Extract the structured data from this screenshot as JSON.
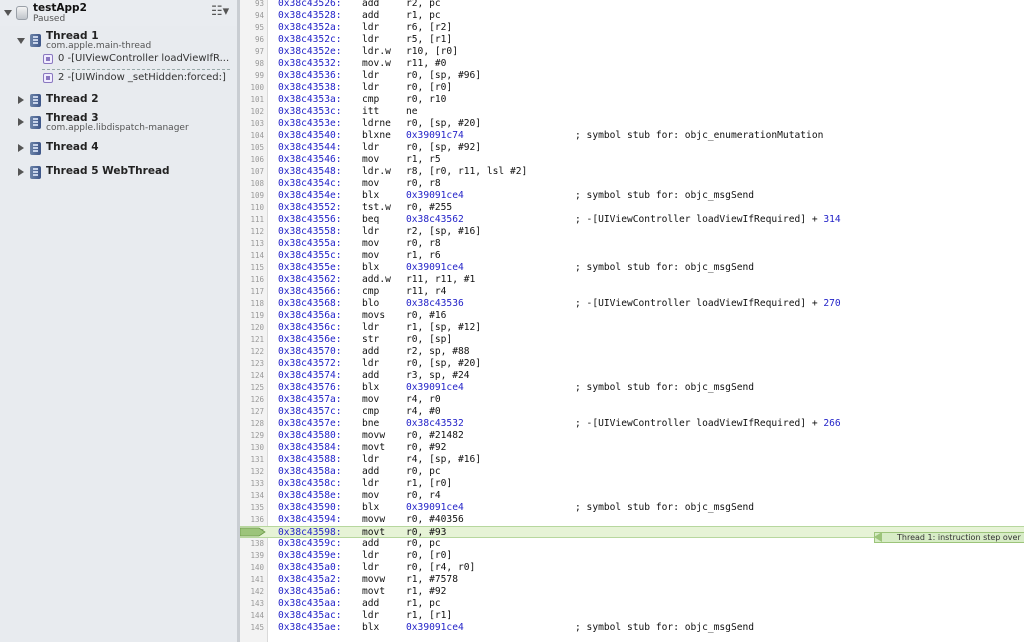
{
  "process": {
    "name": "testApp2",
    "status": "Paused"
  },
  "threads": [
    {
      "label": "Thread 1",
      "subtitle": "com.apple.main-thread",
      "expanded": true
    },
    {
      "label": "Thread 2",
      "subtitle": "",
      "expanded": false
    },
    {
      "label": "Thread 3",
      "subtitle": "com.apple.libdispatch-manager",
      "expanded": false
    },
    {
      "label": "Thread 4",
      "subtitle": "",
      "expanded": false
    },
    {
      "label": "Thread 5 WebThread",
      "subtitle": "",
      "expanded": false
    }
  ],
  "frames": [
    {
      "text": "0 -[UIViewController loadViewIfR..."
    },
    {
      "text": "2 -[UIWindow _setHidden:forced:]"
    }
  ],
  "current_line_annotation": "Thread 1: instruction step over",
  "disassembly": [
    {
      "line": "93",
      "addr": "0x38c43526:",
      "mnemonic": "add",
      "operands": "r2, pc",
      "target": "",
      "comment": "",
      "offset": ""
    },
    {
      "line": "94",
      "addr": "0x38c43528:",
      "mnemonic": "add",
      "operands": "r1, pc",
      "target": "",
      "comment": "",
      "offset": ""
    },
    {
      "line": "95",
      "addr": "0x38c4352a:",
      "mnemonic": "ldr",
      "operands": "r6, [r2]",
      "target": "",
      "comment": "",
      "offset": ""
    },
    {
      "line": "96",
      "addr": "0x38c4352c:",
      "mnemonic": "ldr",
      "operands": "r5, [r1]",
      "target": "",
      "comment": "",
      "offset": ""
    },
    {
      "line": "97",
      "addr": "0x38c4352e:",
      "mnemonic": "ldr.w",
      "operands": "r10, [r0]",
      "target": "",
      "comment": "",
      "offset": ""
    },
    {
      "line": "98",
      "addr": "0x38c43532:",
      "mnemonic": "mov.w",
      "operands": "r11, #0",
      "target": "",
      "comment": "",
      "offset": ""
    },
    {
      "line": "99",
      "addr": "0x38c43536:",
      "mnemonic": "ldr",
      "operands": "r0, [sp, #96]",
      "target": "",
      "comment": "",
      "offset": ""
    },
    {
      "line": "100",
      "addr": "0x38c43538:",
      "mnemonic": "ldr",
      "operands": "r0, [r0]",
      "target": "",
      "comment": "",
      "offset": ""
    },
    {
      "line": "101",
      "addr": "0x38c4353a:",
      "mnemonic": "cmp",
      "operands": "r0, r10",
      "target": "",
      "comment": "",
      "offset": ""
    },
    {
      "line": "102",
      "addr": "0x38c4353c:",
      "mnemonic": "itt",
      "operands": "ne",
      "target": "",
      "comment": "",
      "offset": ""
    },
    {
      "line": "103",
      "addr": "0x38c4353e:",
      "mnemonic": "ldrne",
      "operands": "r0, [sp, #20]",
      "target": "",
      "comment": "",
      "offset": ""
    },
    {
      "line": "104",
      "addr": "0x38c43540:",
      "mnemonic": "blxne",
      "operands": "",
      "target": "0x39091c74",
      "comment": "; symbol stub for: objc_enumerationMutation",
      "offset": ""
    },
    {
      "line": "105",
      "addr": "0x38c43544:",
      "mnemonic": "ldr",
      "operands": "r0, [sp, #92]",
      "target": "",
      "comment": "",
      "offset": ""
    },
    {
      "line": "106",
      "addr": "0x38c43546:",
      "mnemonic": "mov",
      "operands": "r1, r5",
      "target": "",
      "comment": "",
      "offset": ""
    },
    {
      "line": "107",
      "addr": "0x38c43548:",
      "mnemonic": "ldr.w",
      "operands": "r8, [r0, r11, lsl #2]",
      "target": "",
      "comment": "",
      "offset": ""
    },
    {
      "line": "108",
      "addr": "0x38c4354c:",
      "mnemonic": "mov",
      "operands": "r0, r8",
      "target": "",
      "comment": "",
      "offset": ""
    },
    {
      "line": "109",
      "addr": "0x38c4354e:",
      "mnemonic": "blx",
      "operands": "",
      "target": "0x39091ce4",
      "comment": "; symbol stub for: objc_msgSend",
      "offset": ""
    },
    {
      "line": "110",
      "addr": "0x38c43552:",
      "mnemonic": "tst.w",
      "operands": "r0, #255",
      "target": "",
      "comment": "",
      "offset": ""
    },
    {
      "line": "111",
      "addr": "0x38c43556:",
      "mnemonic": "beq",
      "operands": "",
      "target": "0x38c43562",
      "comment": "; -[UIViewController loadViewIfRequired] + ",
      "offset": "314"
    },
    {
      "line": "112",
      "addr": "0x38c43558:",
      "mnemonic": "ldr",
      "operands": "r2, [sp, #16]",
      "target": "",
      "comment": "",
      "offset": ""
    },
    {
      "line": "113",
      "addr": "0x38c4355a:",
      "mnemonic": "mov",
      "operands": "r0, r8",
      "target": "",
      "comment": "",
      "offset": ""
    },
    {
      "line": "114",
      "addr": "0x38c4355c:",
      "mnemonic": "mov",
      "operands": "r1, r6",
      "target": "",
      "comment": "",
      "offset": ""
    },
    {
      "line": "115",
      "addr": "0x38c4355e:",
      "mnemonic": "blx",
      "operands": "",
      "target": "0x39091ce4",
      "comment": "; symbol stub for: objc_msgSend",
      "offset": ""
    },
    {
      "line": "116",
      "addr": "0x38c43562:",
      "mnemonic": "add.w",
      "operands": "r11, r11, #1",
      "target": "",
      "comment": "",
      "offset": ""
    },
    {
      "line": "117",
      "addr": "0x38c43566:",
      "mnemonic": "cmp",
      "operands": "r11, r4",
      "target": "",
      "comment": "",
      "offset": ""
    },
    {
      "line": "118",
      "addr": "0x38c43568:",
      "mnemonic": "blo",
      "operands": "",
      "target": "0x38c43536",
      "comment": "; -[UIViewController loadViewIfRequired] + ",
      "offset": "270"
    },
    {
      "line": "119",
      "addr": "0x38c4356a:",
      "mnemonic": "movs",
      "operands": "r0, #16",
      "target": "",
      "comment": "",
      "offset": ""
    },
    {
      "line": "120",
      "addr": "0x38c4356c:",
      "mnemonic": "ldr",
      "operands": "r1, [sp, #12]",
      "target": "",
      "comment": "",
      "offset": ""
    },
    {
      "line": "121",
      "addr": "0x38c4356e:",
      "mnemonic": "str",
      "operands": "r0, [sp]",
      "target": "",
      "comment": "",
      "offset": ""
    },
    {
      "line": "122",
      "addr": "0x38c43570:",
      "mnemonic": "add",
      "operands": "r2, sp, #88",
      "target": "",
      "comment": "",
      "offset": ""
    },
    {
      "line": "123",
      "addr": "0x38c43572:",
      "mnemonic": "ldr",
      "operands": "r0, [sp, #20]",
      "target": "",
      "comment": "",
      "offset": ""
    },
    {
      "line": "124",
      "addr": "0x38c43574:",
      "mnemonic": "add",
      "operands": "r3, sp, #24",
      "target": "",
      "comment": "",
      "offset": ""
    },
    {
      "line": "125",
      "addr": "0x38c43576:",
      "mnemonic": "blx",
      "operands": "",
      "target": "0x39091ce4",
      "comment": "; symbol stub for: objc_msgSend",
      "offset": ""
    },
    {
      "line": "126",
      "addr": "0x38c4357a:",
      "mnemonic": "mov",
      "operands": "r4, r0",
      "target": "",
      "comment": "",
      "offset": ""
    },
    {
      "line": "127",
      "addr": "0x38c4357c:",
      "mnemonic": "cmp",
      "operands": "r4, #0",
      "target": "",
      "comment": "",
      "offset": ""
    },
    {
      "line": "128",
      "addr": "0x38c4357e:",
      "mnemonic": "bne",
      "operands": "",
      "target": "0x38c43532",
      "comment": "; -[UIViewController loadViewIfRequired] + ",
      "offset": "266"
    },
    {
      "line": "129",
      "addr": "0x38c43580:",
      "mnemonic": "movw",
      "operands": "r0, #21482",
      "target": "",
      "comment": "",
      "offset": ""
    },
    {
      "line": "130",
      "addr": "0x38c43584:",
      "mnemonic": "movt",
      "operands": "r0, #92",
      "target": "",
      "comment": "",
      "offset": ""
    },
    {
      "line": "131",
      "addr": "0x38c43588:",
      "mnemonic": "ldr",
      "operands": "r4, [sp, #16]",
      "target": "",
      "comment": "",
      "offset": ""
    },
    {
      "line": "132",
      "addr": "0x38c4358a:",
      "mnemonic": "add",
      "operands": "r0, pc",
      "target": "",
      "comment": "",
      "offset": ""
    },
    {
      "line": "133",
      "addr": "0x38c4358c:",
      "mnemonic": "ldr",
      "operands": "r1, [r0]",
      "target": "",
      "comment": "",
      "offset": ""
    },
    {
      "line": "134",
      "addr": "0x38c4358e:",
      "mnemonic": "mov",
      "operands": "r0, r4",
      "target": "",
      "comment": "",
      "offset": ""
    },
    {
      "line": "135",
      "addr": "0x38c43590:",
      "mnemonic": "blx",
      "operands": "",
      "target": "0x39091ce4",
      "comment": "; symbol stub for: objc_msgSend",
      "offset": ""
    },
    {
      "line": "136",
      "addr": "0x38c43594:",
      "mnemonic": "movw",
      "operands": "r0, #40356",
      "target": "",
      "comment": "",
      "offset": ""
    },
    {
      "line": "137",
      "addr": "0x38c43598:",
      "mnemonic": "movt",
      "operands": "r0, #93",
      "target": "",
      "comment": "",
      "offset": "",
      "current": true
    },
    {
      "line": "138",
      "addr": "0x38c4359c:",
      "mnemonic": "add",
      "operands": "r0, pc",
      "target": "",
      "comment": "",
      "offset": ""
    },
    {
      "line": "139",
      "addr": "0x38c4359e:",
      "mnemonic": "ldr",
      "operands": "r0, [r0]",
      "target": "",
      "comment": "",
      "offset": ""
    },
    {
      "line": "140",
      "addr": "0x38c435a0:",
      "mnemonic": "ldr",
      "operands": "r0, [r4, r0]",
      "target": "",
      "comment": "",
      "offset": ""
    },
    {
      "line": "141",
      "addr": "0x38c435a2:",
      "mnemonic": "movw",
      "operands": "r1, #7578",
      "target": "",
      "comment": "",
      "offset": ""
    },
    {
      "line": "142",
      "addr": "0x38c435a6:",
      "mnemonic": "movt",
      "operands": "r1, #92",
      "target": "",
      "comment": "",
      "offset": ""
    },
    {
      "line": "143",
      "addr": "0x38c435aa:",
      "mnemonic": "add",
      "operands": "r1, pc",
      "target": "",
      "comment": "",
      "offset": ""
    },
    {
      "line": "144",
      "addr": "0x38c435ac:",
      "mnemonic": "ldr",
      "operands": "r1, [r1]",
      "target": "",
      "comment": "",
      "offset": ""
    },
    {
      "line": "145",
      "addr": "0x38c435ae:",
      "mnemonic": "blx",
      "operands": "",
      "target": "0x39091ce4",
      "comment": "; symbol stub for: objc_msgSend",
      "offset": ""
    }
  ]
}
